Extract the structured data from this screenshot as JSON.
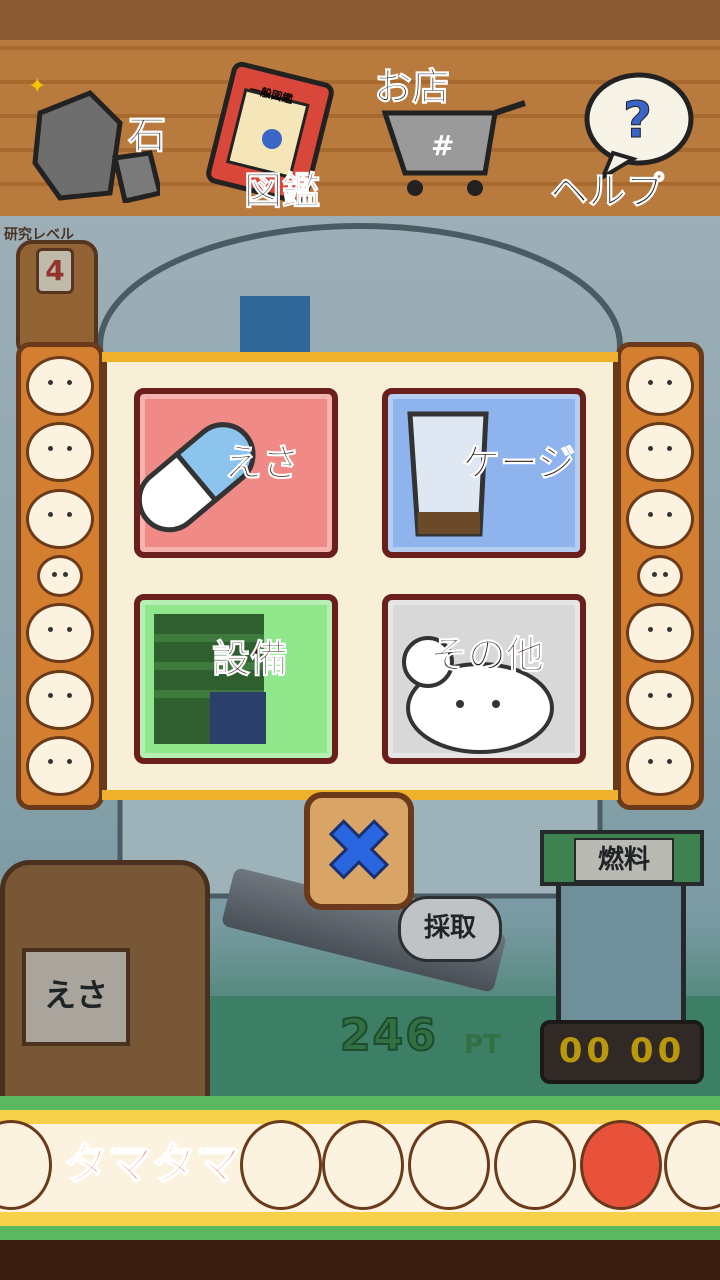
{
  "toolbar": {
    "stone_label": "石",
    "encyclopedia_label": "図鑑",
    "encyclopedia_book_label": "一般図鑑",
    "shop_label": "お店",
    "help_label": "ヘルプ"
  },
  "level": {
    "title": "研究レベル",
    "value": "4"
  },
  "menu": {
    "food_label": "えさ",
    "cage_label": "ケージ",
    "equipment_label": "設備",
    "other_label": "その他"
  },
  "close_label": "✖",
  "scene": {
    "bag_label": "えさ",
    "collect_label": "採取",
    "points_value": "246",
    "points_unit": "PT",
    "fuel_label": "燃料",
    "fuel_value": "00 00"
  },
  "footer": {
    "logo_title": "タマタマ"
  },
  "colors": {
    "food_btn": "#f08a86",
    "cage_btn": "#8fb3ec",
    "equipment_btn": "#8fe68b",
    "other_btn": "#d8d8d8",
    "close_accent": "#2a66e0"
  }
}
